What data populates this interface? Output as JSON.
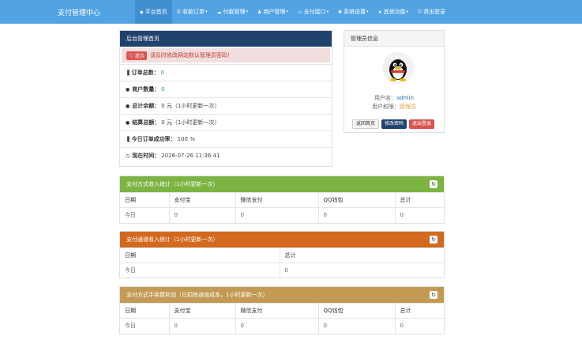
{
  "brand": "支付管理中心",
  "nav": [
    {
      "icon": "home-icon",
      "glyph": "◆",
      "label": "平台首页",
      "caret": ""
    },
    {
      "icon": "list-icon",
      "glyph": "☰",
      "label": "收款订单",
      "caret": "▾"
    },
    {
      "icon": "cloud-icon",
      "glyph": "☁",
      "label": "付款管理",
      "caret": "▾"
    },
    {
      "icon": "user-icon",
      "glyph": "♟",
      "label": "商户管理",
      "caret": "▾"
    },
    {
      "icon": "card-icon",
      "glyph": "▭",
      "label": "支付接口",
      "caret": "▾"
    },
    {
      "icon": "gear-icon",
      "glyph": "✱",
      "label": "系统设置",
      "caret": "▾"
    },
    {
      "icon": "rocket-icon",
      "glyph": "➤",
      "label": "其他功能",
      "caret": "▾"
    },
    {
      "icon": "power-icon",
      "glyph": "⏻",
      "label": "退出登录",
      "caret": ""
    }
  ],
  "admin": {
    "title": "后台管理首页",
    "alert_label": "提示",
    "alert_text": "请及时修改网站默认管理员密码！",
    "stats": [
      {
        "icon": "bar-chart-icon",
        "glyph": "▐",
        "label": "订单总数：",
        "value": "0",
        "highlight": true
      },
      {
        "icon": "drop-icon",
        "glyph": "●",
        "label": "商户数量：",
        "value": "0",
        "highlight": true
      },
      {
        "icon": "drop-icon",
        "glyph": "●",
        "label": "总计余额：",
        "value": "0 元（1小时更新一次）",
        "highlight": false
      },
      {
        "icon": "drop-icon",
        "glyph": "●",
        "label": "结算总额：",
        "value": "0 元（1小时更新一次）",
        "highlight": false
      },
      {
        "icon": "bar-chart-icon",
        "glyph": "▐",
        "label": "今日订单成功率：",
        "value": "100 %",
        "highlight": false
      },
      {
        "icon": "clock-icon",
        "glyph": "◷",
        "label": "现在时间：",
        "value": "2026-07-26 11:36:41",
        "highlight": false
      }
    ]
  },
  "user": {
    "title": "管理员信息",
    "name_label": "用户名：",
    "name": "admin",
    "role_label": "用户权限：",
    "role": "管理员",
    "btn_home": "返回首页",
    "btn_pwd": "修改密码",
    "btn_logout": "退出登录"
  },
  "way_stats": {
    "title": "支付方式收入统计（1小时更新一次）",
    "headers": [
      "日期",
      "支付宝",
      "微信支付",
      "QQ钱包",
      "总计"
    ],
    "row": [
      "今日",
      "0",
      "0",
      "0",
      "0"
    ]
  },
  "channel_stats": {
    "title": "支付通道收入统计（1小时更新一次）",
    "headers": [
      "日期",
      "总计"
    ],
    "row": [
      "今日",
      "0"
    ]
  },
  "fee_stats": {
    "title": "支付方式手续费利润（已扣除通道成本，1小时更新一次）",
    "headers": [
      "日期",
      "支付宝",
      "微信支付",
      "QQ钱包",
      "总计"
    ],
    "row": [
      "今日",
      "0",
      "0",
      "0",
      "0"
    ]
  },
  "refresh_glyph": "↻"
}
